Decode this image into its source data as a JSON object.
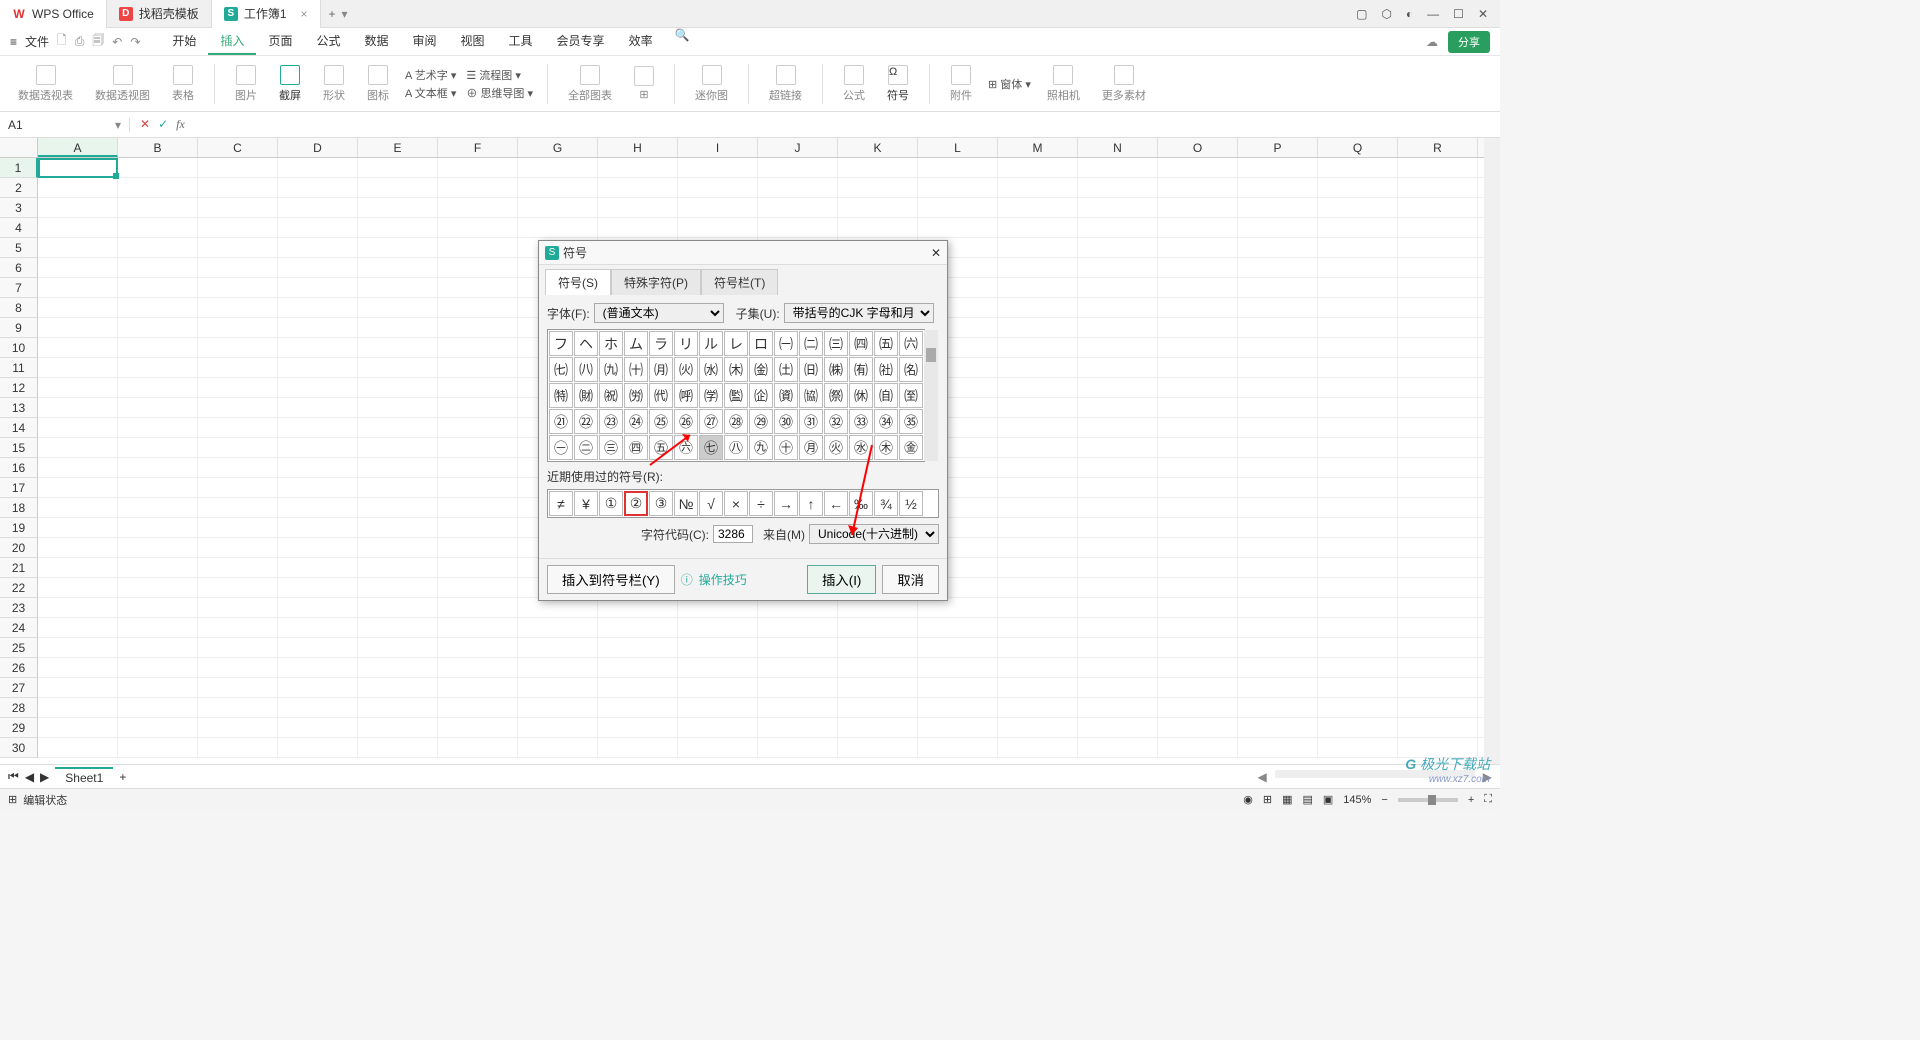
{
  "title_tabs": {
    "wps": "WPS Office",
    "docer": "找稻壳模板",
    "book": "工作簿1"
  },
  "file_menu": "文件",
  "menu": {
    "start": "开始",
    "insert": "插入",
    "page": "页面",
    "formula": "公式",
    "data": "数据",
    "review": "审阅",
    "view": "视图",
    "tool": "工具",
    "vip": "会员专享",
    "eff": "效率"
  },
  "share": "分享",
  "ribbon": {
    "pivot1": "数据透视表",
    "pivot2": "数据透视图",
    "table": "表格",
    "pic": "图片",
    "screenshot": "截屏",
    "shape": "形状",
    "icon": "图标",
    "art": "艺术字",
    "textbox": "文本框",
    "flow": "流程图",
    "mind": "思维导图",
    "chart": "全部图表",
    "mini": "迷你图",
    "link": "超链接",
    "fx": "公式",
    "symbol": "符号",
    "attach": "附件",
    "form": "窗体",
    "camera": "照相机",
    "more": "更多素材"
  },
  "namebox": "A1",
  "cols": [
    "A",
    "B",
    "C",
    "D",
    "E",
    "F",
    "G",
    "H",
    "I",
    "J",
    "K",
    "L",
    "M",
    "N",
    "O",
    "P",
    "Q",
    "R"
  ],
  "rows": [
    "1",
    "2",
    "3",
    "4",
    "5",
    "6",
    "7",
    "8",
    "9",
    "10",
    "11",
    "12",
    "13",
    "14",
    "15",
    "16",
    "17",
    "18",
    "19",
    "20",
    "21",
    "22",
    "23",
    "24",
    "25",
    "26",
    "27",
    "28",
    "29",
    "30"
  ],
  "sheet": "Sheet1",
  "status": "编辑状态",
  "zoom": "145%",
  "dialog": {
    "title": "符号",
    "tab_symbol": "符号(S)",
    "tab_special": "特殊字符(P)",
    "tab_bar": "符号栏(T)",
    "font_label": "字体(F):",
    "font_value": "(普通文本)",
    "subset_label": "子集(U):",
    "subset_value": "带括号的CJK 字母和月份",
    "grid": [
      [
        "フ",
        "ヘ",
        "ホ",
        "ム",
        "ラ",
        "リ",
        "ル",
        "レ",
        "ロ",
        "㈠",
        "㈡",
        "㈢",
        "㈣",
        "㈤",
        "㈥"
      ],
      [
        "㈦",
        "㈧",
        "㈨",
        "㈩",
        "㈪",
        "㈫",
        "㈬",
        "㈭",
        "㈮",
        "㈯",
        "㈰",
        "㈱",
        "㈲",
        "㈳",
        "㈴"
      ],
      [
        "㈵",
        "㈶",
        "㈷",
        "㈸",
        "㈹",
        "㈺",
        "㈻",
        "㈼",
        "㈽",
        "㈾",
        "㈿",
        "㉀",
        "㉁",
        "㉂",
        "㉃"
      ],
      [
        "㉑",
        "㉒",
        "㉓",
        "㉔",
        "㉕",
        "㉖",
        "㉗",
        "㉘",
        "㉙",
        "㉚",
        "㉛",
        "㉜",
        "㉝",
        "㉞",
        "㉟"
      ],
      [
        "㊀",
        "㊁",
        "㊂",
        "㊃",
        "㊄",
        "㊅",
        "㊆",
        "㊇",
        "㊈",
        "㊉",
        "㊊",
        "㊋",
        "㊌",
        "㊍",
        "㊎"
      ]
    ],
    "selected_r": 4,
    "selected_c": 6,
    "recent_label": "近期使用过的符号(R):",
    "recent": [
      "≠",
      "¥",
      "①",
      "②",
      "③",
      "№",
      "√",
      "×",
      "÷",
      "→",
      "↑",
      "←",
      "‰",
      "¾",
      "½"
    ],
    "code_label": "字符代码(C):",
    "code_value": "3286",
    "from_label": "来自(M)",
    "from_value": "Unicode(十六进制)",
    "insert_bar": "插入到符号栏(Y)",
    "tips": "操作技巧",
    "insert": "插入(I)",
    "cancel": "取消"
  },
  "watermark": {
    "main": "极光下载站",
    "sub": "www.xz7.com"
  }
}
